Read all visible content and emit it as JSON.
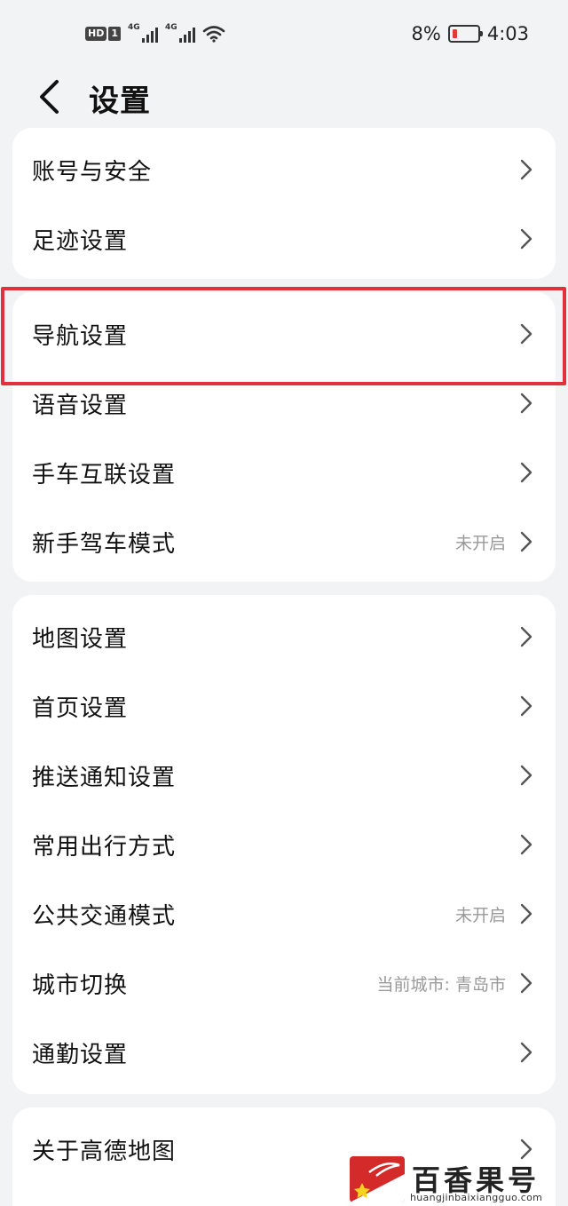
{
  "status_bar": {
    "hd_label": "HD",
    "sim_label": "1",
    "network1": "4G",
    "network2": "4G",
    "battery_percent": "8%",
    "battery_level": 0.08,
    "time": "4:03"
  },
  "header": {
    "title": "设置"
  },
  "groups": [
    {
      "items": [
        {
          "label": "账号与安全",
          "value": ""
        },
        {
          "label": "足迹设置",
          "value": ""
        }
      ]
    },
    {
      "items": [
        {
          "label": "导航设置",
          "value": ""
        },
        {
          "label": "语音设置",
          "value": ""
        },
        {
          "label": "手车互联设置",
          "value": ""
        },
        {
          "label": "新手驾车模式",
          "value": "未开启"
        }
      ]
    },
    {
      "items": [
        {
          "label": "地图设置",
          "value": ""
        },
        {
          "label": "首页设置",
          "value": ""
        },
        {
          "label": "推送通知设置",
          "value": ""
        },
        {
          "label": "常用出行方式",
          "value": ""
        },
        {
          "label": "公共交通模式",
          "value": "未开启"
        },
        {
          "label": "城市切换",
          "value": "当前城市: 青岛市"
        },
        {
          "label": "通勤设置",
          "value": ""
        }
      ]
    },
    {
      "items": [
        {
          "label": "关于高德地图",
          "value": ""
        }
      ]
    }
  ],
  "watermark": {
    "brand": "百香果号",
    "url": "huangjinbaixiangguo.com"
  },
  "colors": {
    "highlight": "#e0313d",
    "background": "#f2f3f5",
    "battery_low": "#e53935"
  }
}
